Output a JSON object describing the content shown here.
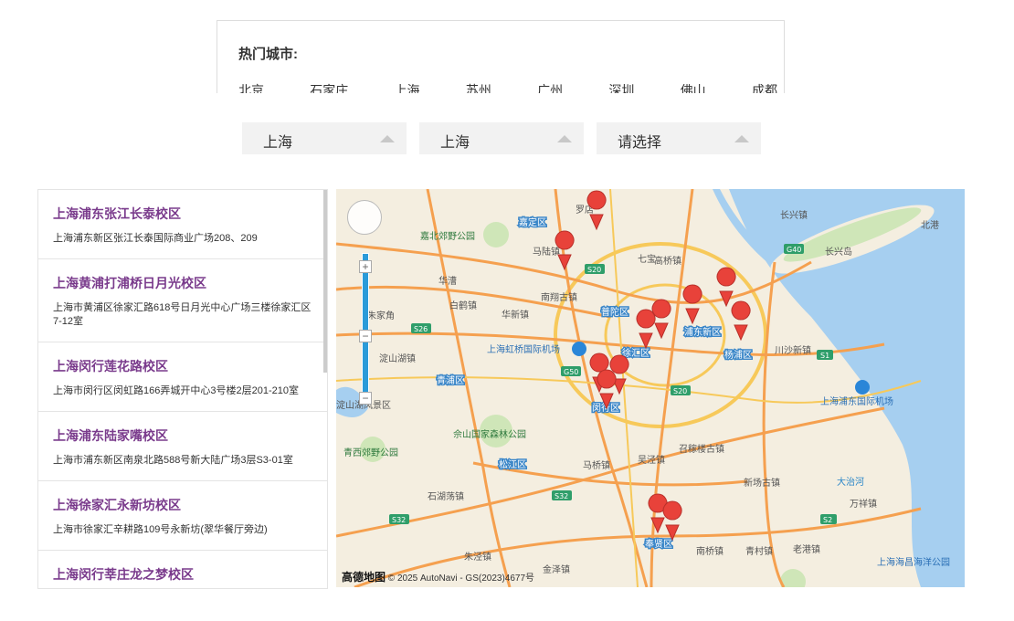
{
  "hot": {
    "title": "热门城市:",
    "cities": [
      "北京",
      "石家庄",
      "上海",
      "苏州",
      "广州",
      "深圳",
      "佛山",
      "成都"
    ]
  },
  "selects": {
    "province": "上海",
    "city": "上海",
    "district": "请选择"
  },
  "schools": [
    {
      "name": "上海浦东张江长泰校区",
      "address": "上海浦东新区张江长泰国际商业广场208、209"
    },
    {
      "name": "上海黄浦打浦桥日月光校区",
      "address": "上海市黄浦区徐家汇路618号日月光中心广场三楼徐家汇区7-12室"
    },
    {
      "name": "上海闵行莲花路校区",
      "address": "上海市闵行区闵虹路166弄城开中心3号楼2层201-210室"
    },
    {
      "name": "上海浦东陆家嘴校区",
      "address": "上海市浦东新区南泉北路588号新大陆广场3层S3-01室"
    },
    {
      "name": "上海徐家汇永新坊校区",
      "address": "上海市徐家汇辛耕路109号永新坊(翠华餐厅旁边)"
    },
    {
      "name": "上海闵行莘庄龙之梦校区",
      "address": ""
    }
  ],
  "map": {
    "labels": {
      "jiading": "嘉定区",
      "jiabei": "嘉北郊野公园",
      "luodian": "罗店",
      "malu": "马陆镇",
      "nanxiang": "南翔古镇",
      "putuo": "普陀区",
      "huaxin": "华新镇",
      "baihe": "白鹤镇",
      "zhujiajiao": "朱家角",
      "xujiahui": "徐汇区",
      "qingpu": "青浦区",
      "hongqiao": "上海虹桥国际机场",
      "dianshan": "淀山湖镇",
      "dianshanlake": "淀山湖风景区",
      "sheshan": "佘山国家森林公园",
      "qingxi": "青西郊野公园",
      "songjiang": "松江区",
      "minhang": "闵行区",
      "pudong": "浦东新区",
      "yangpu": "杨浦区",
      "gaoqiao": "高桥镇",
      "changxing": "长兴岛",
      "changxingzhen": "长兴镇",
      "beigang": "北港",
      "chuansha": "川沙新镇",
      "pudongairport": "上海浦东国际机场",
      "zhaojialou": "召稼楼古镇",
      "fengxian": "奉贤区",
      "xinchang": "新场古镇",
      "dazhihe": "大治河",
      "wanxiang": "万祥镇",
      "qingcun": "青村镇",
      "nanqiao": "南桥镇",
      "shijie": "石湖荡镇",
      "zhujing": "朱泾镇",
      "haiyang": "上海海昌海洋公园",
      "laogang": "老港镇",
      "wujing": "吴泾镇",
      "maqiao": "马桥镇",
      "huacao": "华漕",
      "qibao": "七宝",
      "jinze": "金泽镇"
    },
    "roads": [
      "S26",
      "G50",
      "S20",
      "S32",
      "S32",
      "G40",
      "S1",
      "S20",
      "S2"
    ],
    "logo": "高德地图",
    "copyright": "© 2025 AutoNavi - GS(2023)4677号",
    "colors": {
      "water": "#a6cff0",
      "land": "#f4eee0",
      "green": "#cfe6b8",
      "road": "#f5a04f",
      "highway": "#f7c95a",
      "marker": "#e8423a"
    }
  }
}
